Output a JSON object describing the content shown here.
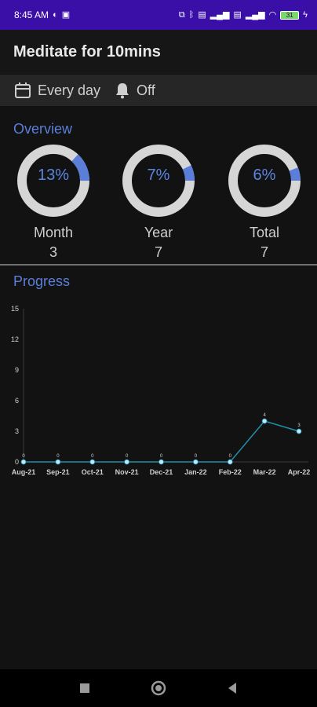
{
  "status_bar": {
    "time": "8:45 AM",
    "battery": "31"
  },
  "header": {
    "title": "Meditate for 10mins"
  },
  "schedule": {
    "frequency": "Every day",
    "reminder": "Off"
  },
  "overview": {
    "title": "Overview",
    "stats": [
      {
        "percent_label": "13%",
        "fraction": 0.13,
        "label": "Month",
        "value": "3"
      },
      {
        "percent_label": "7%",
        "fraction": 0.07,
        "label": "Year",
        "value": "7"
      },
      {
        "percent_label": "6%",
        "fraction": 0.06,
        "label": "Total",
        "value": "7"
      }
    ]
  },
  "progress": {
    "title": "Progress"
  },
  "colors": {
    "accent": "#5b7fd8",
    "ring_track": "#d6d6d6",
    "line": "#1f8fa8",
    "point": "#bfe8ff"
  },
  "chart_data": {
    "type": "line",
    "x": [
      "Aug-21",
      "Sep-21",
      "Oct-21",
      "Nov-21",
      "Dec-21",
      "Jan-22",
      "Feb-22",
      "Mar-22",
      "Apr-22"
    ],
    "series": [
      {
        "values": [
          0,
          0,
          0,
          0,
          0,
          0,
          0,
          4,
          3
        ]
      }
    ],
    "data_labels": [
      "0",
      "0",
      "0",
      "0",
      "0",
      "0",
      "0",
      "4",
      "3"
    ],
    "y_ticks": [
      "0",
      "3",
      "6",
      "9",
      "12",
      "15"
    ],
    "ylim": [
      0,
      15
    ],
    "grid": false
  }
}
